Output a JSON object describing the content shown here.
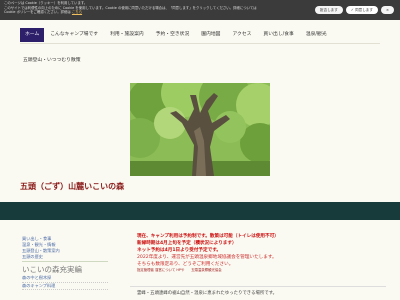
{
  "cookie": {
    "line1": "このページは Cookie（クッキー）を利用しています。",
    "line2": "このサイトでは利便性の向上のために Cookie を使用しています。Cookie の使用に同意いただける場合は、「同意します」をクリックしてください。詳細については",
    "line3": "Cookie ポリシーをご確認ください。詳細は",
    "link": "こちら",
    "decline": "拒否します",
    "accept": "✓ 同意します",
    "close": "×"
  },
  "nav": {
    "items": [
      "ホーム",
      "こんなキャンプ場です",
      "利用・施設案内",
      "予約・空き状況",
      "園内地図",
      "アクセス",
      "買い出し/食事",
      "温泉/観光"
    ],
    "row2": [
      "五頭登山・いつつむり散策"
    ]
  },
  "page_title": "五頭（ごず）山麓いこいの森",
  "sidebar": {
    "links": [
      "買い出し・食事",
      "温泉・観光・情報",
      "五頭登山・散策案内",
      "五頭の歴史"
    ],
    "section_title": "いこいの森充実編",
    "sub_links": [
      "森の中と樹木探",
      "森のキャンプ料理"
    ]
  },
  "notice": {
    "lines": [
      "現在、キャンプ利用は予約制です。散策は可能（トイレは使用不可）",
      "新緑時期は4月上旬を予定（積状況によります）",
      "ネット予約は4月1日より受付予定です。",
      "2022年度より、運営先が五頭温泉郷地域協議会を管理いたします。",
      "そちらも数限定あり、どうぞご利用ください。"
    ],
    "small": "指定管理者 運営について HPや　　五頭温泉郷観光協会"
  },
  "bottom_text": "霊峰・五頭連峰の裾山自然・温泉に恵まれたゆったりできる場所です。"
}
